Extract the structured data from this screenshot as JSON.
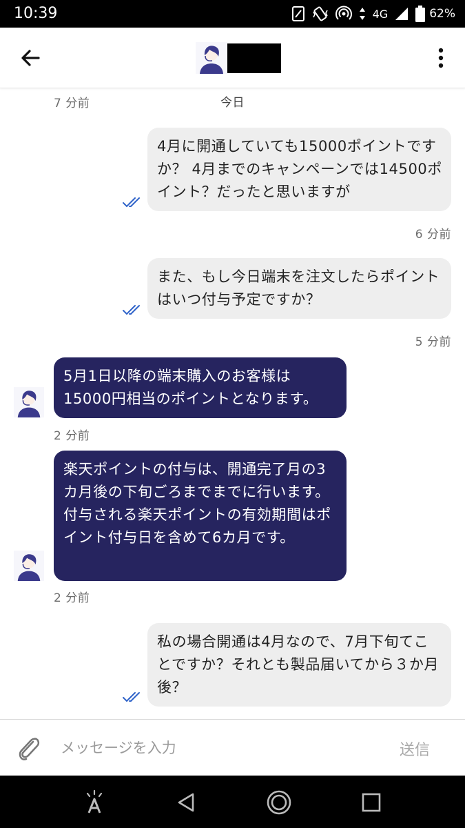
{
  "status_bar": {
    "time": "10:39",
    "network": "4G",
    "battery": "62%",
    "icons": [
      "nfc-icon",
      "vibrate-icon",
      "hotspot-icon",
      "data-arrows-icon",
      "signal-icon",
      "battery-icon"
    ]
  },
  "header": {
    "icons": [
      "back-arrow-icon",
      "agent-avatar-icon",
      "more-vert-icon"
    ]
  },
  "chat": {
    "top_left_time": "7 分前",
    "date_divider": "今日",
    "messages": [
      {
        "direction": "outgoing",
        "text": "4月に開通していても15000ポイントですか？ 4月までのキャンペーンでは14500ポイント？だったと思いますが",
        "time": "6 分前",
        "read": true
      },
      {
        "direction": "outgoing",
        "text": "また、もし今日端末を注文したらポイントはいつ付与予定ですか？",
        "time": "5 分前",
        "read": true
      },
      {
        "direction": "incoming",
        "text": "5月1日以降の端末購入のお客様は15000円相当のポイントとなります。",
        "time": "2 分前"
      },
      {
        "direction": "incoming",
        "text": "楽天ポイントの付与は、開通完了月の3カ月後の下旬ごろまでまでに行います。\n付与される楽天ポイントの有効期間はポイント付与日を含めて6カ月です。",
        "time": "2 分前"
      },
      {
        "direction": "outgoing",
        "text": "私の場合開通は4月なので、7月下旬てことですか？それとも製品届いてから３か月後？",
        "time": "",
        "read": true
      }
    ]
  },
  "input": {
    "placeholder": "メッセージを入力",
    "send_label": "送信",
    "attach_icon": "paperclip-icon"
  },
  "nav_bar": {
    "icons": [
      "assist-icon",
      "back-triangle-icon",
      "home-circle-icon",
      "recents-square-icon"
    ]
  },
  "colors": {
    "incoming_bubble": "#26245f",
    "outgoing_bubble": "#eeeeee",
    "read_check": "#2f63c9",
    "avatar_accent": "#3b3a8c"
  }
}
